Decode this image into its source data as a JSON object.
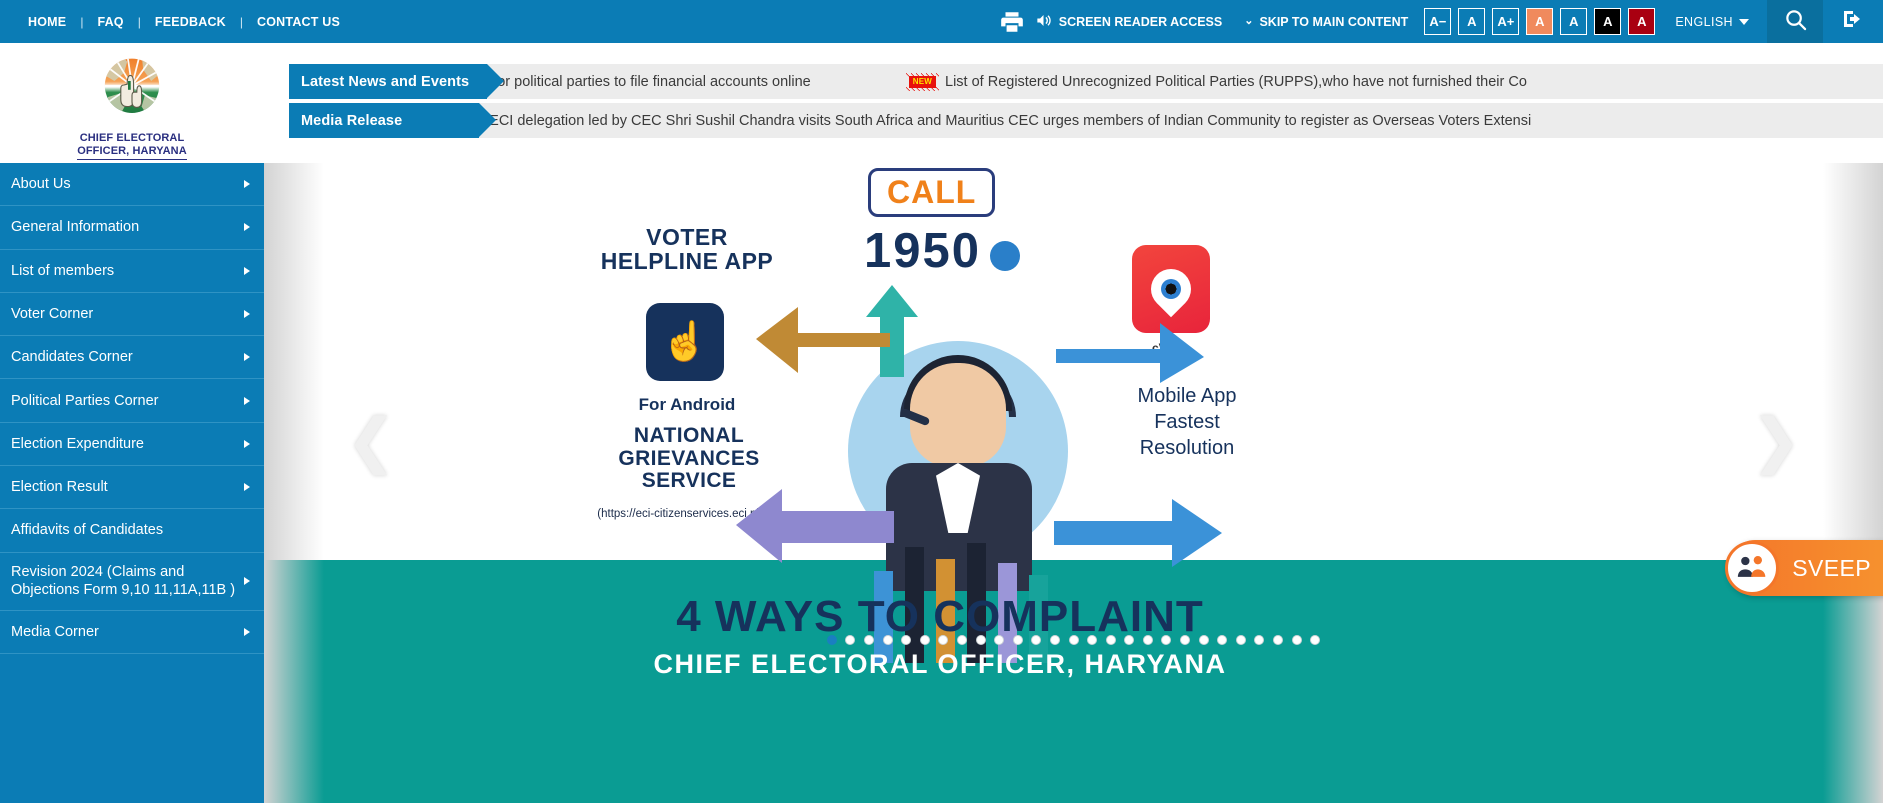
{
  "topbar": {
    "links": [
      {
        "label": "HOME"
      },
      {
        "label": "FAQ"
      },
      {
        "label": "FEEDBACK"
      },
      {
        "label": "CONTACT US"
      }
    ],
    "separator": "|",
    "print_icon": "printer-icon",
    "screen_reader_label": "SCREEN READER ACCESS",
    "skip_main_label": "SKIP TO MAIN CONTENT",
    "font_buttons": [
      {
        "label": "A−",
        "name": "font-decrease"
      },
      {
        "label": "A",
        "name": "font-normal"
      },
      {
        "label": "A+",
        "name": "font-increase"
      }
    ],
    "contrast_buttons": [
      {
        "label": "A",
        "name": "contrast-orange",
        "color": "#f08a5d"
      },
      {
        "label": "A",
        "name": "contrast-default",
        "color": "transparent"
      },
      {
        "label": "A",
        "name": "contrast-black",
        "color": "#000000"
      },
      {
        "label": "A",
        "name": "contrast-dark-red",
        "color": "#a90011"
      }
    ],
    "language": "ENGLISH",
    "search_icon": "search-icon",
    "login_icon": "login-icon",
    "bg_color": "#0b7cb5"
  },
  "brand": {
    "line1": "CHIEF ELECTORAL",
    "line2": "OFFICER, HARYANA",
    "emblem_name": "eci-india-emblem"
  },
  "tickers": [
    {
      "label": "Latest News and Events",
      "text": "ote for political parties to file financial accounts online",
      "badge": "NEW",
      "text2": "List of Registered Unrecognized Political Parties (RUPPS),who have not furnished their Co"
    },
    {
      "label": "Media Release",
      "text": "\"ECI delegation led by CEC Shri Sushil Chandra visits South Africa and Mauritius CEC urges members of Indian Community to register as Overseas Voters Extensi"
    }
  ],
  "sidebar": {
    "items": [
      {
        "label": "About Us",
        "has_arrow": true
      },
      {
        "label": "General Information",
        "has_arrow": true
      },
      {
        "label": "List of members",
        "has_arrow": true
      },
      {
        "label": "Voter Corner",
        "has_arrow": true
      },
      {
        "label": "Candidates Corner",
        "has_arrow": true
      },
      {
        "label": "Political Parties Corner",
        "has_arrow": true
      },
      {
        "label": "Election Expenditure",
        "has_arrow": true
      },
      {
        "label": "Election Result",
        "has_arrow": true
      },
      {
        "label": "Affidavits of Candidates",
        "has_arrow": false
      },
      {
        "label": "Revision 2024 (Claims and Objections Form 9,10 11,11A,11B )",
        "has_arrow": true
      },
      {
        "label": "Media Corner",
        "has_arrow": true
      }
    ],
    "bg_color": "#0b7cb5"
  },
  "banner": {
    "call_label": "CALL",
    "number": "1950",
    "voter_app_title": "VOTER\nHELPLINE APP",
    "voter_app_sub": "For Android",
    "ngs_title": "NATIONAL\nGRIEVANCES\nSERVICE",
    "ngs_url": "(https://eci-citizenservices.eci.nic.in)",
    "cvigil_label": "cVIGIL",
    "cvigil_text": "Mobile App\nFastest\nResolution",
    "headline": "4 WAYS TO COMPLAINT",
    "subhead": "CHIEF ELECTORAL OFFICER, HARYANA",
    "prev_icon": "chevron-left-icon",
    "next_icon": "chevron-right-icon",
    "dots_total": 27,
    "dot_active_index": 0
  },
  "sveep": {
    "label": "SVEEP",
    "icon": "people-group-icon",
    "color": "#f4762a"
  }
}
